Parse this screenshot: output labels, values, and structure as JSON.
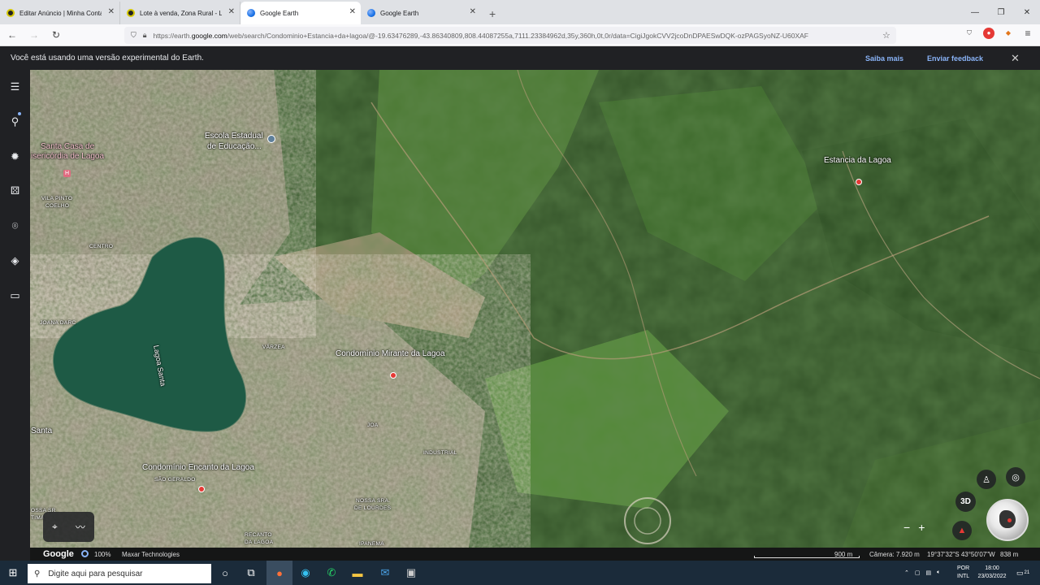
{
  "browser": {
    "tabs": [
      {
        "title": "Editar Anúncio | Minha Conta | ",
        "icon": "olx-icon"
      },
      {
        "title": "Lote à venda, Zona Rural - Lagoa",
        "icon": "olx-icon"
      },
      {
        "title": "Google Earth",
        "icon": "earth-icon",
        "active": true
      },
      {
        "title": "Google Earth",
        "icon": "earth-icon"
      }
    ],
    "new_tab": "+",
    "url_prefix": "https://earth.",
    "url_domain": "google.com",
    "url_rest": "/web/search/Condominio+Estancia+da+lagoa/@-19.63476289,-43.86340809,808.44087255a,7111.23384962d,35y,360h,0t,0r/data=CigiJgokCVV2jcoDnDPAESwDQK-ozPAGSyoNZ-U60XAF"
  },
  "notice": {
    "message": "Você está usando uma versão experimental do Earth.",
    "learn_more": "Saiba mais",
    "feedback": "Enviar feedback"
  },
  "map": {
    "labels": [
      {
        "id": "escola-1",
        "text": "Escola Estadual"
      },
      {
        "id": "escola-2",
        "text": "de Educação..."
      },
      {
        "id": "santa-casa-1",
        "text": "Santa Casa de"
      },
      {
        "id": "santa-casa-2",
        "text": "isericórdia de Lagoa"
      },
      {
        "id": "vila-pinto-1",
        "text": "VILA PINTO"
      },
      {
        "id": "vila-pinto-2",
        "text": "COELHO"
      },
      {
        "id": "centro",
        "text": "CENTRO"
      },
      {
        "id": "joana-darc",
        "text": "JOANA DARC"
      },
      {
        "id": "lagoa-santa",
        "text": "Lagoa Santa"
      },
      {
        "id": "varzea",
        "text": "VÁRZEA"
      },
      {
        "id": "mirante",
        "text": "Condomínio Mirante da Lagoa"
      },
      {
        "id": "estancia",
        "text": "Estancia da Lagoa"
      },
      {
        "id": "santa",
        "text": "Santa"
      },
      {
        "id": "joa",
        "text": "JOA"
      },
      {
        "id": "industrial",
        "text": "INDUSTRIAL"
      },
      {
        "id": "encanto",
        "text": "Condomínio Encanto da Lagoa"
      },
      {
        "id": "sao-geraldo",
        "text": "SÃO GERALDO"
      },
      {
        "id": "nossa-sra-1",
        "text": "NOSSA SRA."
      },
      {
        "id": "nossa-sra-2",
        "text": "DE LOURDES"
      },
      {
        "id": "recanto-1",
        "text": "RECANTO"
      },
      {
        "id": "recanto-2",
        "text": "DA LAGOA"
      },
      {
        "id": "ossa-1",
        "text": "OSSA SR"
      },
      {
        "id": "ossa-2",
        "text": "TIMA"
      },
      {
        "id": "ipanema",
        "text": "IPANEMA"
      }
    ],
    "button_3d": "3D"
  },
  "status": {
    "google": "Google",
    "load": "100%",
    "attribution": "Maxar Technologies",
    "scale": "900 m",
    "camera": "Câmera: 7.920 m",
    "coords": "19°37'32\"S 43°50'07\"W",
    "elevation": "838 m"
  },
  "taskbar": {
    "search_placeholder": "Digite aqui para pesquisar",
    "lang_1": "POR",
    "lang_2": "INTL",
    "time": "18:00",
    "date": "23/03/2022",
    "notifications": "21"
  }
}
